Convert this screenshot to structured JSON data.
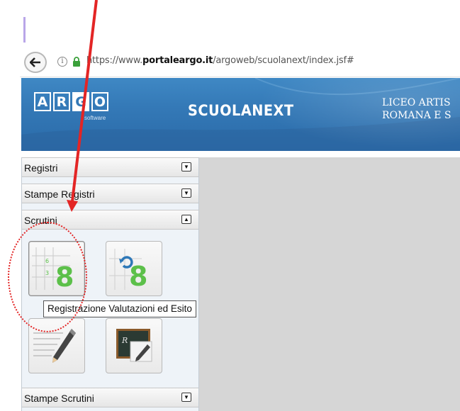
{
  "browser": {
    "url_prefix": "https://www.",
    "url_domain": "portaleargo.it",
    "url_path": "/argoweb/scuolanext/index.jsf#",
    "icons": [
      "back-arrow-icon",
      "info-icon",
      "lock-icon"
    ]
  },
  "header": {
    "logo_letters": [
      "A",
      "R",
      "G",
      "O"
    ],
    "logo_sub": "software",
    "product": "SCUOLANEXT",
    "school_line1": "LICEO ARTIS",
    "school_line2": "ROMANA E S"
  },
  "sidebar": {
    "sections": [
      {
        "label": "Registri",
        "state": "collapsed"
      },
      {
        "label": "Stampe Registri",
        "state": "collapsed"
      },
      {
        "label": "Scrutini",
        "state": "expanded"
      },
      {
        "label": "Stampe Scrutini",
        "state": "collapsed"
      }
    ],
    "scrutini_tiles": [
      {
        "icon": "registrazione-valutazioni-icon",
        "glyph_small_top": "6",
        "glyph_small_bottom": "3",
        "glyph_big": "8"
      },
      {
        "icon": "caricamento-voti-refresh-icon",
        "glyph_big": "8"
      },
      {
        "icon": "pencil-document-icon"
      },
      {
        "icon": "blackboard-pencil-icon",
        "board_text": "R"
      }
    ],
    "tooltip": "Registrazione Valutazioni ed Esito"
  },
  "colors": {
    "banner": "#3479b7",
    "annotation_red": "#e32525",
    "icon_green": "#5cc04a",
    "content_gray": "#d6d6d6"
  }
}
